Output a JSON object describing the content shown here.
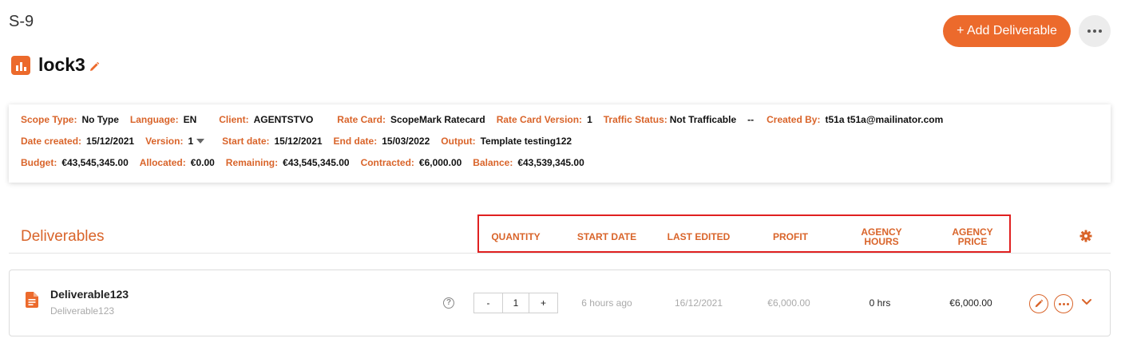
{
  "page": {
    "id": "S-9",
    "title": "lock3"
  },
  "actions": {
    "add_label": "+ Add Deliverable"
  },
  "info": {
    "row1": [
      {
        "label": "Scope Type:",
        "value": "No Type"
      },
      {
        "label": "Language:",
        "value": "EN"
      },
      {
        "label": "Client:",
        "value": "AGENTSTVO"
      },
      {
        "label": "Rate Card:",
        "value": "ScopeMark Ratecard"
      },
      {
        "label": "Rate Card Version:",
        "value": "1"
      },
      {
        "label": "Traffic Status:",
        "value": "Not Trafficable"
      },
      {
        "label": "",
        "value": "--"
      },
      {
        "label": "Created By:",
        "value": "t51a t51a@mailinator.com"
      }
    ],
    "row2": {
      "date_created_label": "Date created:",
      "date_created": "15/12/2021",
      "version_label": "Version:",
      "version": "1",
      "start_label": "Start date:",
      "start": "15/12/2021",
      "end_label": "End date:",
      "end": "15/03/2022",
      "output_label": "Output:",
      "output": "Template testing122"
    },
    "row3": [
      {
        "label": "Budget:",
        "value": "€43,545,345.00"
      },
      {
        "label": "Allocated:",
        "value": "€0.00"
      },
      {
        "label": "Remaining:",
        "value": "€43,545,345.00"
      },
      {
        "label": "Contracted:",
        "value": "€6,000.00"
      },
      {
        "label": "Balance:",
        "value": "€43,539,345.00"
      }
    ]
  },
  "deliverables": {
    "section_title": "Deliverables",
    "columns": {
      "quantity": "QUANTITY",
      "start_date": "START DATE",
      "last_edited": "LAST EDITED",
      "profit": "PROFIT",
      "agency_hours_1": "AGENCY",
      "agency_hours_2": "HOURS",
      "agency_price_1": "AGENCY",
      "agency_price_2": "PRICE"
    },
    "rows": [
      {
        "name": "Deliverable123",
        "subtitle": "Deliverable123",
        "help": "?",
        "minus": "-",
        "quantity": "1",
        "plus": "+",
        "start_date": "6 hours ago",
        "last_edited": "16/12/2021",
        "profit": "€6,000.00",
        "agency_hours": "0 hrs",
        "agency_price": "€6,000.00"
      }
    ]
  },
  "colors": {
    "accent": "#ec6a2c",
    "label": "#d9642a",
    "highlight": "#e02020"
  }
}
